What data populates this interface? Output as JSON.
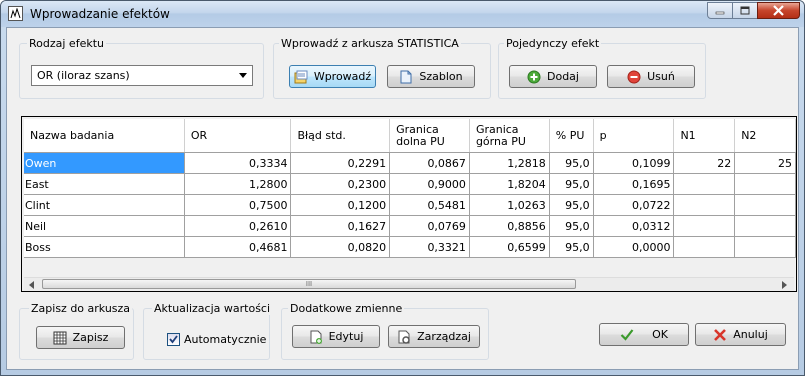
{
  "window": {
    "title": "Wprowadzanie efektów"
  },
  "group_effect_type": {
    "label": "Rodzaj efektu",
    "selected": "OR (iloraz szans)"
  },
  "group_import": {
    "label": "Wprowadź z arkusza STATISTICA",
    "enter_label": "Wprowadź",
    "template_label": "Szablon"
  },
  "group_single": {
    "label": "Pojedynczy efekt",
    "add_label": "Dodaj",
    "remove_label": "Usuń"
  },
  "table": {
    "headers": [
      "Nazwa badania",
      "OR",
      "Błąd std.",
      "Granica dolna PU",
      "Granica górna PU",
      "% PU",
      "p",
      "N1",
      "N2"
    ],
    "header_lines": [
      [
        "Nazwa badania"
      ],
      [
        "OR"
      ],
      [
        "Błąd std."
      ],
      [
        "Granica",
        "dolna PU"
      ],
      [
        "Granica",
        "górna PU"
      ],
      [
        "% PU"
      ],
      [
        "p"
      ],
      [
        "N1"
      ],
      [
        "N2"
      ]
    ],
    "rows": [
      [
        "Owen",
        "0,3334",
        "0,2291",
        "0,0867",
        "1,2818",
        "95,0",
        "0,1099",
        "22",
        "25"
      ],
      [
        "East",
        "1,2800",
        "0,2300",
        "0,9000",
        "1,8204",
        "95,0",
        "0,1695",
        "",
        ""
      ],
      [
        "Clint",
        "0,7500",
        "0,1200",
        "0,5481",
        "1,0263",
        "95,0",
        "0,0722",
        "",
        ""
      ],
      [
        "Neil",
        "0,2610",
        "0,1627",
        "0,0769",
        "0,8856",
        "95,0",
        "0,0312",
        "",
        ""
      ],
      [
        "Boss",
        "0,4681",
        "0,0820",
        "0,3321",
        "0,6599",
        "95,0",
        "0,0000",
        "",
        ""
      ]
    ],
    "scroll_grip": "III"
  },
  "group_save": {
    "label": "Zapisz do arkusza",
    "save_label": "Zapisz"
  },
  "group_update": {
    "label": "Aktualizacja wartości",
    "auto_label": "Automatycznie",
    "auto_checked": true
  },
  "group_extra": {
    "label": "Dodatkowe zmienne",
    "edit_label": "Edytuj",
    "manage_label": "Zarządzaj"
  },
  "footer": {
    "ok_label": "OK",
    "cancel_label": "Anuluj"
  },
  "colors": {
    "selection": "#3399ff",
    "titlebar": "#c3d6ec",
    "close": "#c6452c"
  }
}
